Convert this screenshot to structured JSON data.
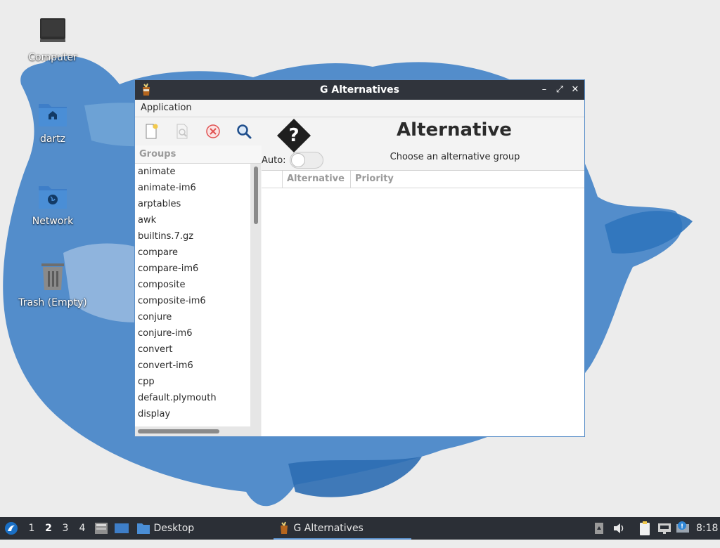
{
  "desktop": {
    "icons": [
      {
        "label": "Computer"
      },
      {
        "label": "dartz"
      },
      {
        "label": "Network"
      },
      {
        "label": "Trash (Empty)"
      }
    ]
  },
  "window": {
    "title": "G Alternatives",
    "controls": {
      "minimize": "–",
      "maximize": "⤢",
      "close": "✕"
    },
    "menu": {
      "application": "Application"
    },
    "groups_header": "Groups",
    "groups": [
      "animate",
      "animate-im6",
      "arptables",
      "awk",
      "builtins.7.gz",
      "compare",
      "compare-im6",
      "composite",
      "composite-im6",
      "conjure",
      "conjure-im6",
      "convert",
      "convert-im6",
      "cpp",
      "default.plymouth",
      "display"
    ],
    "heading": "Alternative",
    "subheading": "Choose an alternative group",
    "auto_label": "Auto:",
    "auto_enabled": false,
    "table_columns": [
      "",
      "Alternative",
      "Priority"
    ]
  },
  "taskbar": {
    "workspaces": [
      "1",
      "2",
      "3",
      "4"
    ],
    "active_workspace": "2",
    "desktop_label": "Desktop",
    "task_label": "G Alternatives",
    "clock": "8:18"
  },
  "colors": {
    "accent": "#5a8fc9",
    "titlebar": "#30343c",
    "taskbar": "#2b2f36"
  }
}
